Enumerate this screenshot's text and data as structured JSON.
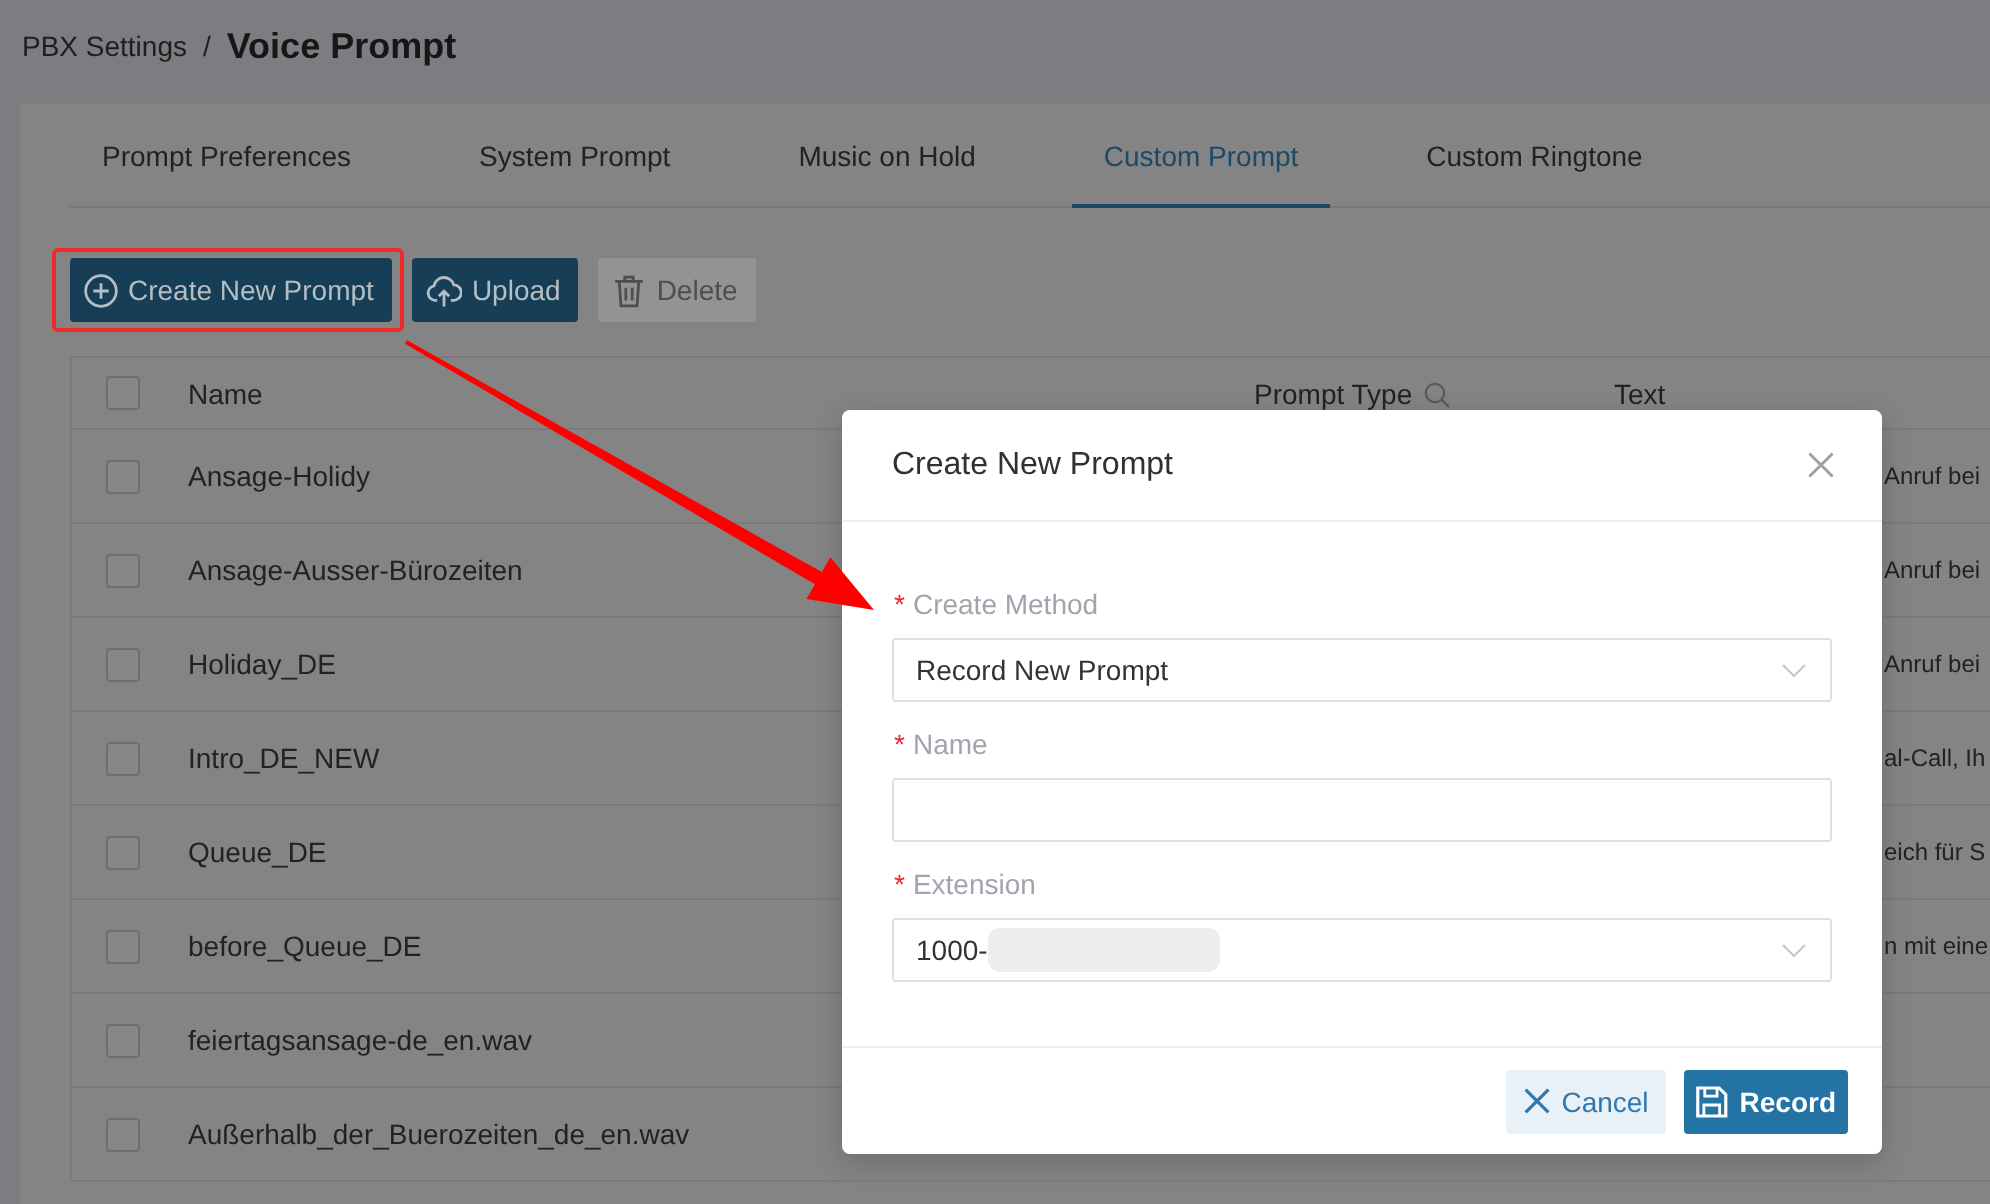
{
  "breadcrumb": {
    "parent": "PBX Settings",
    "separator": "/",
    "current": "Voice Prompt"
  },
  "tabs": [
    {
      "label": "Prompt Preferences",
      "selected": false
    },
    {
      "label": "System Prompt",
      "selected": false
    },
    {
      "label": "Music on Hold",
      "selected": false
    },
    {
      "label": "Custom Prompt",
      "selected": true
    },
    {
      "label": "Custom Ringtone",
      "selected": false
    }
  ],
  "toolbar": [
    {
      "kind": "create",
      "label": "Create New Prompt",
      "disabled": false
    },
    {
      "kind": "upload",
      "label": "Upload",
      "disabled": false
    },
    {
      "kind": "delete",
      "label": "Delete",
      "disabled": true
    }
  ],
  "table": {
    "select_all_checked": false,
    "columns": [
      {
        "label": "Name"
      },
      {
        "label": "Prompt Type",
        "filter": true
      },
      {
        "label": "Text"
      }
    ],
    "rows": [
      {
        "checked": false,
        "name": "Ansage-Holidy",
        "text": "Anruf bei"
      },
      {
        "checked": false,
        "name": "Ansage-Ausser-Bürozeiten",
        "text": "Anruf bei"
      },
      {
        "checked": false,
        "name": "Holiday_DE",
        "text": "Anruf bei"
      },
      {
        "checked": false,
        "name": "Intro_DE_NEW",
        "text": "al-Call, Ih"
      },
      {
        "checked": false,
        "name": "Queue_DE",
        "text": "eich für S"
      },
      {
        "checked": false,
        "name": "before_Queue_DE",
        "text": "n mit eine"
      },
      {
        "checked": false,
        "name": "feiertagsansage-de_en.wav"
      },
      {
        "checked": false,
        "name": "Außerhalb_der_Buerozeiten_de_en.wav"
      }
    ]
  },
  "dialog": {
    "title": "Create New Prompt",
    "fields": [
      {
        "kind": "select",
        "required_mark": "*",
        "label": "Create Method",
        "value": "Record New Prompt"
      },
      {
        "kind": "input",
        "required_mark": "*",
        "label": "Name"
      },
      {
        "kind": "select",
        "required_mark": "*",
        "label": "Extension",
        "value": "1000-",
        "redacted": true
      }
    ],
    "buttons": [
      {
        "kind": "cancel",
        "label": "Cancel"
      },
      {
        "kind": "record",
        "label": "Record"
      }
    ]
  }
}
